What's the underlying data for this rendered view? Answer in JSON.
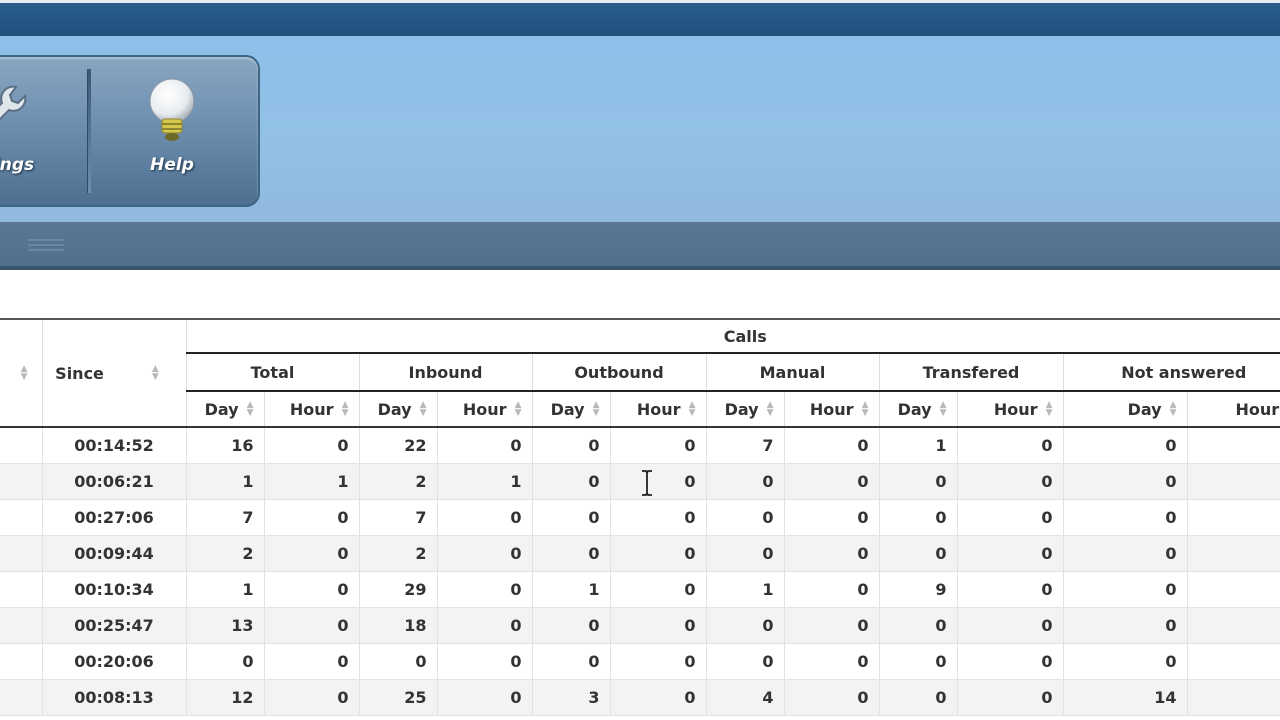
{
  "toolbar": {
    "settings_label": "Settings",
    "help_label": "Help"
  },
  "table": {
    "group_title": "Calls",
    "since_header": "Since",
    "groups": [
      "Total",
      "Inbound",
      "Outbound",
      "Manual",
      "Transfered",
      "Not answered"
    ],
    "sub_day": "Day",
    "sub_hour": "Hour",
    "rows": [
      {
        "since": "00:14:52",
        "cells": [
          "16",
          "0",
          "22",
          "0",
          "0",
          "0",
          "7",
          "0",
          "1",
          "0",
          "0"
        ]
      },
      {
        "since": "00:06:21",
        "cells": [
          "1",
          "1",
          "2",
          "1",
          "0",
          "0",
          "0",
          "0",
          "0",
          "0",
          "0"
        ]
      },
      {
        "since": "00:27:06",
        "cells": [
          "7",
          "0",
          "7",
          "0",
          "0",
          "0",
          "0",
          "0",
          "0",
          "0",
          "0"
        ]
      },
      {
        "since": "00:09:44",
        "cells": [
          "2",
          "0",
          "2",
          "0",
          "0",
          "0",
          "0",
          "0",
          "0",
          "0",
          "0"
        ]
      },
      {
        "since": "00:10:34",
        "cells": [
          "1",
          "0",
          "29",
          "0",
          "1",
          "0",
          "1",
          "0",
          "9",
          "0",
          "0"
        ]
      },
      {
        "since": "00:25:47",
        "cells": [
          "13",
          "0",
          "18",
          "0",
          "0",
          "0",
          "0",
          "0",
          "0",
          "0",
          "0"
        ]
      },
      {
        "since": "00:20:06",
        "cells": [
          "0",
          "0",
          "0",
          "0",
          "0",
          "0",
          "0",
          "0",
          "0",
          "0",
          "0"
        ]
      },
      {
        "since": "00:08:13",
        "cells": [
          "12",
          "0",
          "25",
          "0",
          "3",
          "0",
          "4",
          "0",
          "0",
          "0",
          "14"
        ]
      }
    ]
  }
}
